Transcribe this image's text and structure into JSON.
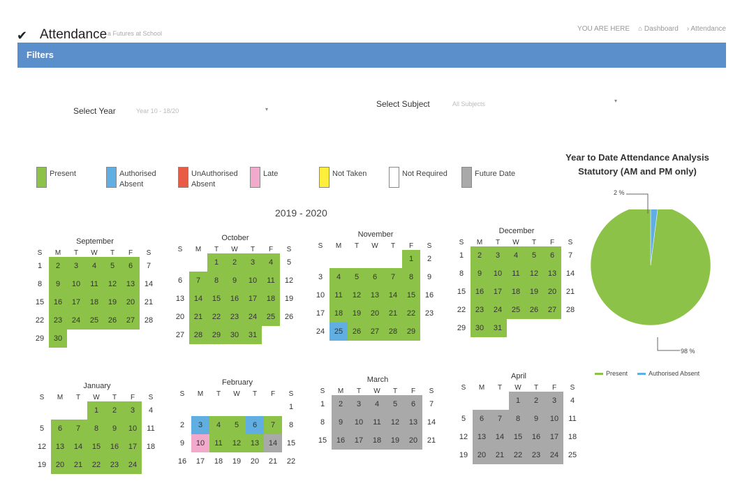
{
  "header": {
    "title": "Attendance",
    "subtitle": "a Futures at School",
    "breadcrumbs": [
      "YOU ARE HERE",
      "Dashboard",
      "Attendance"
    ]
  },
  "filters": {
    "heading": "Filters",
    "year_label": "Select Year",
    "year_value": "Year 10 - 18/20",
    "subject_label": "Select Subject",
    "subject_value": "All Subjects"
  },
  "legend": [
    {
      "label": "Present",
      "color": "#8dc249"
    },
    {
      "label": "Authorised Absent",
      "color": "#61aee3"
    },
    {
      "label": "UnAuthorised Absent",
      "color": "#e85c45"
    },
    {
      "label": "Late",
      "color": "#f1aacb"
    },
    {
      "label": "Not Taken",
      "color": "#ffee3b"
    },
    {
      "label": "Not Required",
      "color": "#ffffff"
    },
    {
      "label": "Future Date",
      "color": "#a9a9a9"
    }
  ],
  "calendar": {
    "year_title": "2019 - 2020",
    "dow": [
      "S",
      "M",
      "T",
      "W",
      "T",
      "F",
      "S"
    ],
    "months": [
      {
        "name": "September",
        "start": 0,
        "days": 30,
        "status": {
          "present": [
            2,
            3,
            4,
            5,
            6,
            9,
            10,
            11,
            12,
            13,
            16,
            17,
            18,
            19,
            20,
            23,
            24,
            25,
            26,
            27,
            30
          ]
        }
      },
      {
        "name": "October",
        "start": 2,
        "days": 31,
        "status": {
          "present": [
            1,
            2,
            3,
            4,
            7,
            8,
            9,
            10,
            11,
            14,
            15,
            16,
            17,
            18,
            21,
            22,
            23,
            24,
            25,
            28,
            29,
            30,
            31
          ]
        }
      },
      {
        "name": "November",
        "start": 5,
        "days": 29,
        "status": {
          "present": [
            1,
            4,
            5,
            6,
            7,
            8,
            11,
            12,
            13,
            14,
            15,
            18,
            19,
            20,
            21,
            22,
            26,
            27,
            28,
            29
          ],
          "authabs": [
            25
          ]
        }
      },
      {
        "name": "December",
        "start": 0,
        "days": 31,
        "status": {
          "present": [
            2,
            3,
            4,
            5,
            6,
            9,
            10,
            11,
            12,
            13,
            16,
            17,
            18,
            19,
            20,
            23,
            24,
            25,
            26,
            27,
            30,
            31
          ]
        }
      },
      {
        "name": "January",
        "start": 3,
        "days": 24,
        "status": {
          "present": [
            1,
            2,
            3,
            6,
            7,
            8,
            9,
            10,
            13,
            14,
            15,
            16,
            17,
            20,
            21,
            22,
            23,
            24
          ]
        }
      },
      {
        "name": "February",
        "start": 6,
        "days": 22,
        "status": {
          "present": [
            4,
            5,
            7,
            11,
            12,
            13
          ],
          "authabs": [
            3,
            6
          ],
          "late": [
            10
          ],
          "future": [
            14
          ]
        }
      },
      {
        "name": "March",
        "start": 0,
        "days": 21,
        "status": {
          "future": [
            2,
            3,
            4,
            5,
            6,
            9,
            10,
            11,
            12,
            13,
            16,
            17,
            18,
            19,
            20
          ]
        }
      },
      {
        "name": "April",
        "start": 3,
        "days": 25,
        "status": {
          "future": [
            1,
            2,
            3,
            6,
            7,
            8,
            9,
            10,
            13,
            14,
            15,
            16,
            17,
            20,
            21,
            22,
            23,
            24
          ]
        }
      }
    ]
  },
  "analysis": {
    "title_line1": "Year to Date Attendance Analysis",
    "title_line2": "Statutory (AM and PM only)",
    "chart_data": {
      "type": "pie",
      "slices": [
        {
          "label": "Present",
          "value": 98,
          "color": "#8dc249"
        },
        {
          "label": "Authorised Absent",
          "value": 2,
          "color": "#61aee3"
        }
      ],
      "data_labels": [
        "98 %",
        "2 %"
      ],
      "legend": "bottom"
    }
  }
}
